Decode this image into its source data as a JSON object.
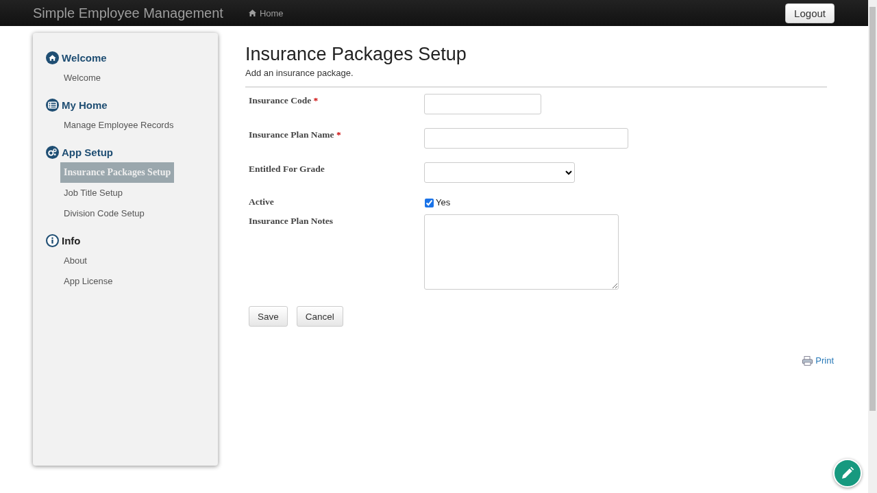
{
  "navbar": {
    "brand": "Simple Employee Management",
    "home_link": "Home",
    "logout": "Logout"
  },
  "sidebar": {
    "sections": [
      {
        "title": "Welcome",
        "items": [
          {
            "label": "Welcome",
            "selected": false
          }
        ]
      },
      {
        "title": "My Home",
        "items": [
          {
            "label": "Manage Employee Records",
            "selected": false
          }
        ]
      },
      {
        "title": "App Setup",
        "items": [
          {
            "label": "Insurance Packages Setup",
            "selected": true
          },
          {
            "label": "Job Title Setup",
            "selected": false
          },
          {
            "label": "Division Code Setup",
            "selected": false
          }
        ]
      },
      {
        "title": "Info",
        "items": [
          {
            "label": "About",
            "selected": false
          },
          {
            "label": "App License",
            "selected": false
          }
        ]
      }
    ]
  },
  "page": {
    "title": "Insurance Packages Setup",
    "subtitle": "Add an insurance package.",
    "fields": [
      {
        "kind": "text",
        "label": "Insurance Code",
        "required_mark": "*"
      },
      {
        "kind": "text",
        "label": "Insurance Plan Name",
        "required_mark": "*"
      },
      {
        "kind": "select",
        "label": "Entitled For Grade"
      },
      {
        "kind": "checkbox",
        "label": "Active",
        "checked": true,
        "option": "Yes"
      },
      {
        "kind": "textarea",
        "label": "Insurance Plan Notes"
      }
    ],
    "buttons": [
      "Save",
      "Cancel"
    ],
    "print_link": "Print"
  }
}
